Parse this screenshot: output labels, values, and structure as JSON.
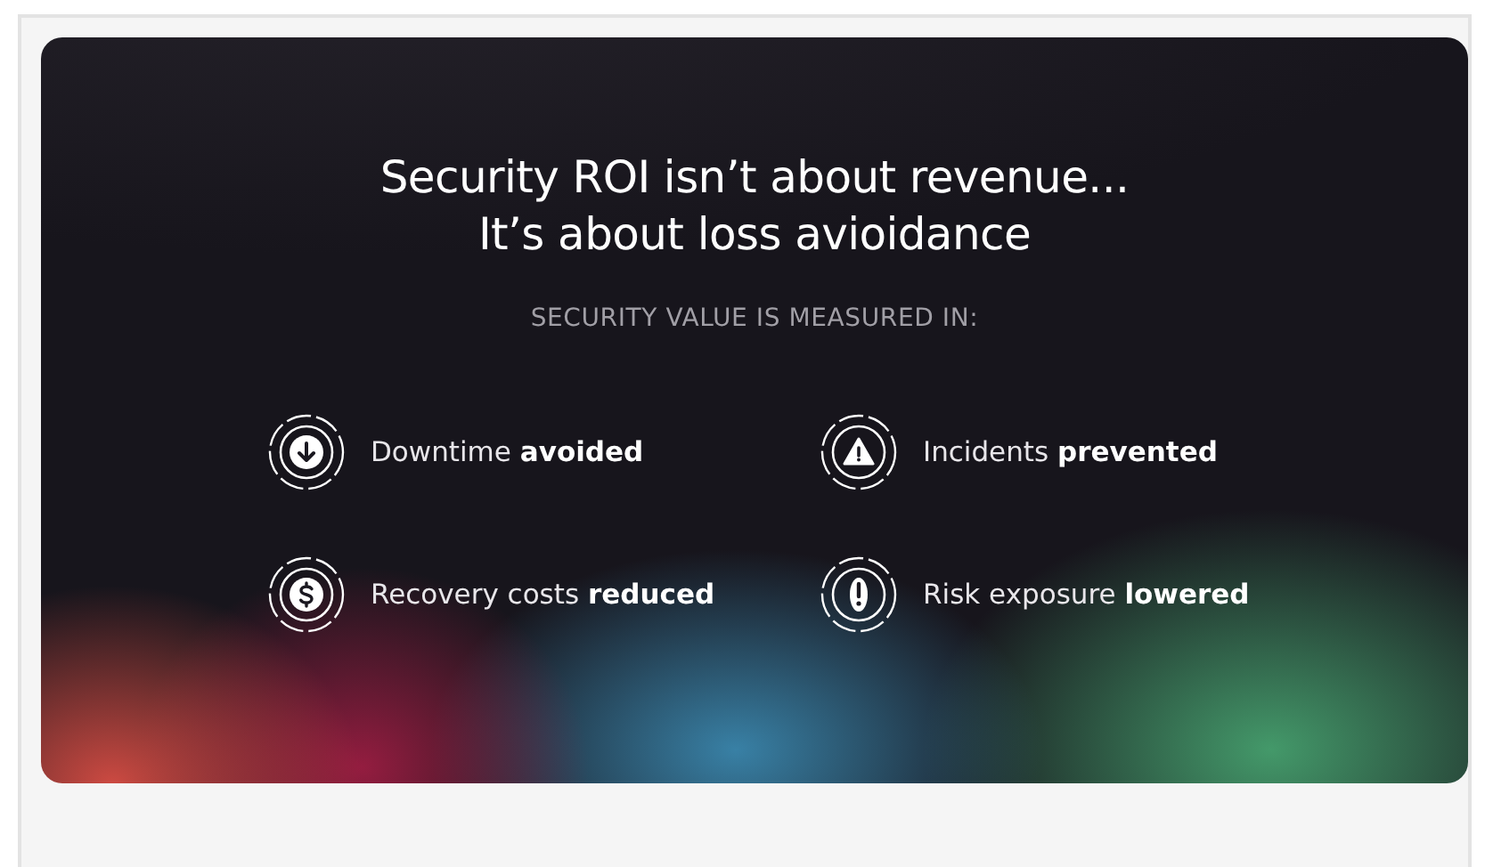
{
  "card": {
    "title_lines": [
      "Security ROI isn’t about revenue...",
      "It’s about loss avioidance"
    ],
    "subtitle": "SECURITY VALUE IS MEASURED IN:",
    "items": [
      {
        "kind": "arrow-down",
        "text": "Downtime **avoided**"
      },
      {
        "kind": "warning",
        "text": "Incidents **prevented**"
      },
      {
        "kind": "dollar",
        "text": "Recovery costs **reduced**"
      },
      {
        "kind": "exclamation",
        "text": "Risk exposure **lowered**"
      }
    ]
  }
}
